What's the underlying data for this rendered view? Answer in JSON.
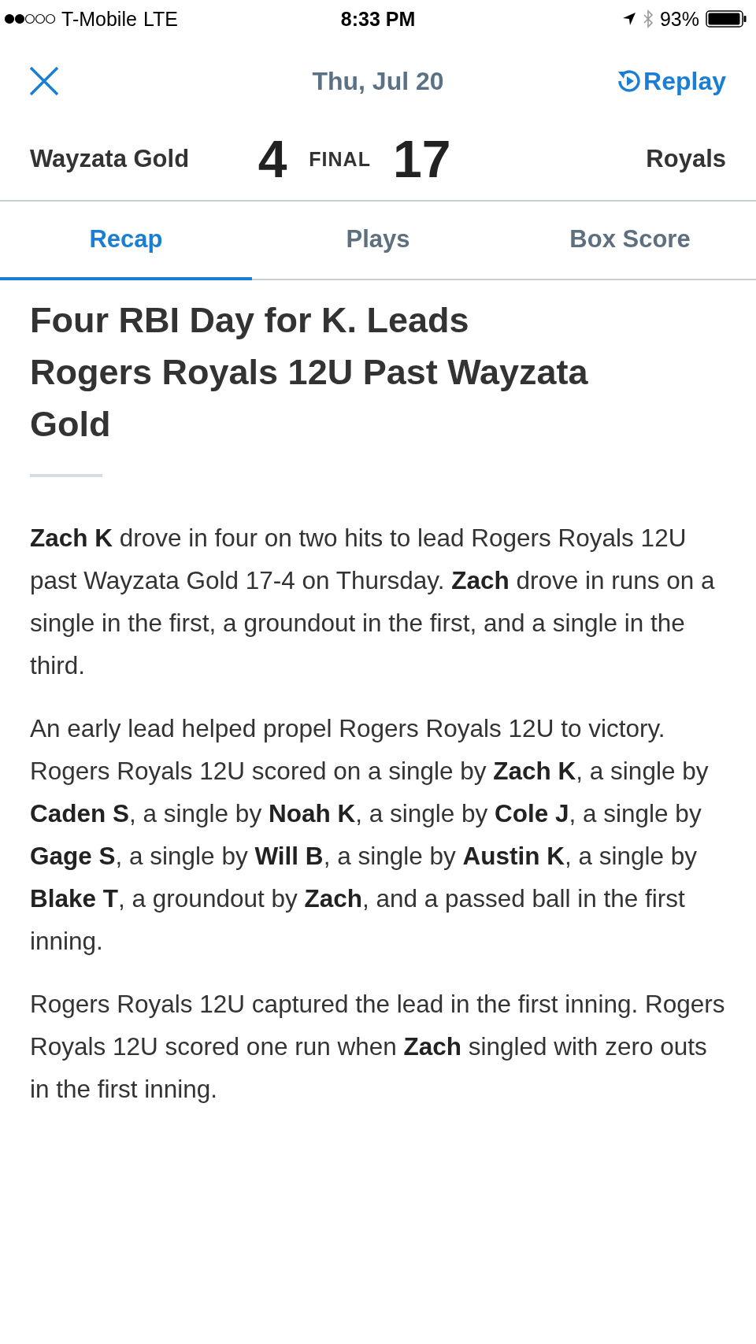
{
  "status_bar": {
    "carrier": "T-Mobile",
    "network": "LTE",
    "time": "8:33 PM",
    "battery": "93%"
  },
  "header": {
    "date": "Thu, Jul 20",
    "replay": "Replay"
  },
  "score": {
    "away_team": "Wayzata Gold",
    "away_score": "4",
    "status": "FINAL",
    "home_score": "17",
    "home_team": "Royals"
  },
  "tabs": [
    {
      "label": "Recap",
      "selected": true
    },
    {
      "label": "Plays",
      "selected": false
    },
    {
      "label": "Box Score",
      "selected": false
    }
  ],
  "article": {
    "headline": "Four RBI Day for K. Leads Rogers Royals 12U Past Wayzata Gold",
    "paragraphs": [
      "**Zach K** drove in four on two hits to lead Rogers Royals 12U past Wayzata Gold 17-4 on Thursday.  **Zach** drove in runs on a single in the first, a groundout in the first, and a single in the third.",
      "An early lead helped propel Rogers Royals 12U to victory.  Rogers Royals 12U scored on a single by **Zach K**, a single by **Caden S**, a single by **Noah K**, a single by **Cole  J**, a single by **Gage S**, a single by **Will B**, a single by **Austin K**, a single by **Blake T**, a groundout by **Zach**, and a passed ball  in the first inning.",
      "Rogers Royals 12U captured the lead in the first inning.  Rogers Royals 12U scored one run when **Zach** singled with zero outs in the first inning."
    ]
  }
}
